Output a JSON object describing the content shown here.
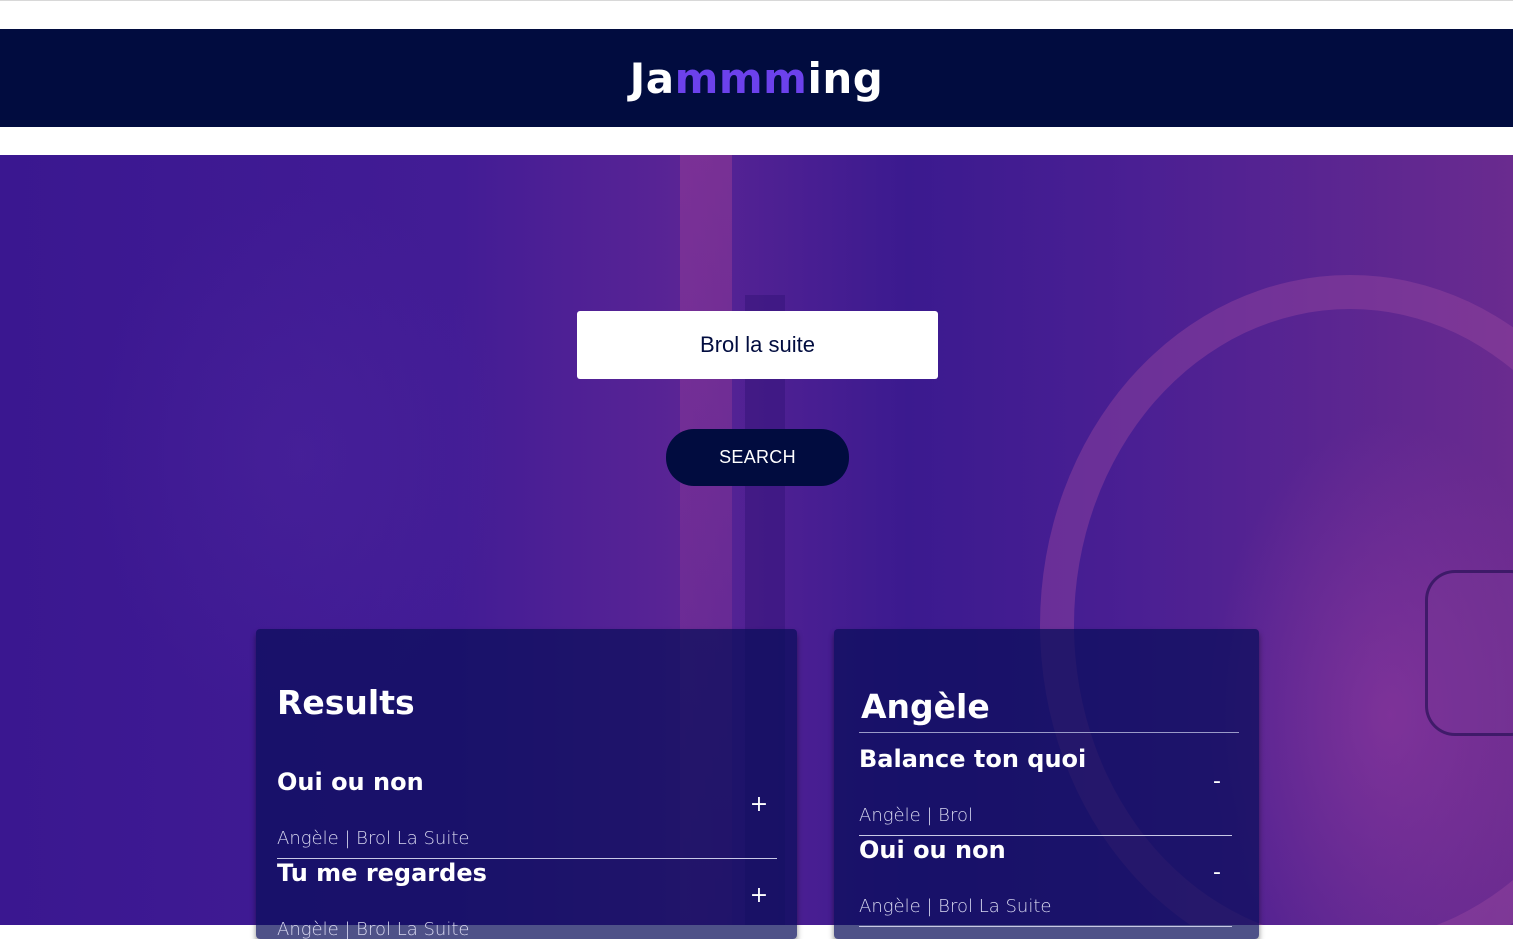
{
  "app": {
    "logo_prefix": "Ja",
    "logo_accent": "mmm",
    "logo_suffix": "ing",
    "accent_color": "#6c41ec",
    "header_color": "#010c3f"
  },
  "search": {
    "value": "Brol la suite",
    "button_label": "SEARCH"
  },
  "results": {
    "title": "Results",
    "add_label": "+",
    "tracks": [
      {
        "name": "Oui ou non",
        "info": "Angèle | Brol La Suite"
      },
      {
        "name": "Tu me regardes",
        "info": "Angèle | Brol La Suite"
      }
    ]
  },
  "playlist": {
    "name": "Angèle",
    "remove_label": "-",
    "tracks": [
      {
        "name": "Balance ton quoi",
        "info": "Angèle | Brol"
      },
      {
        "name": "Oui ou non",
        "info": "Angèle | Brol La Suite"
      }
    ]
  }
}
